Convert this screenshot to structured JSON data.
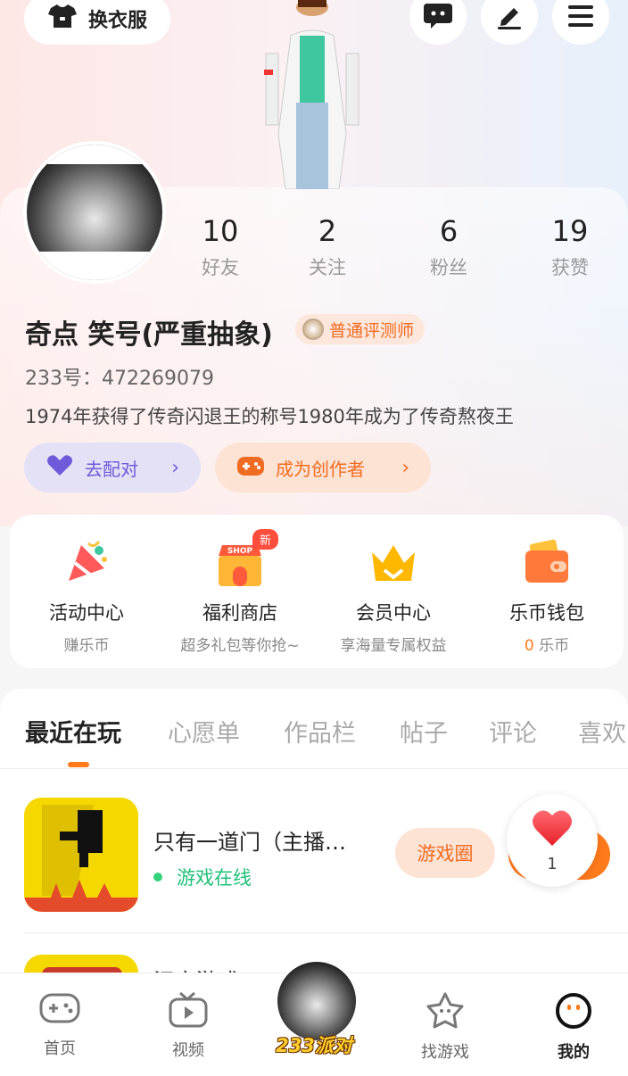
{
  "header": {
    "outfit_label": "换衣服",
    "icons": [
      "chat-icon",
      "edit-icon",
      "menu-icon"
    ]
  },
  "profile": {
    "stats": [
      {
        "value": "10",
        "label": "好友"
      },
      {
        "value": "2",
        "label": "关注"
      },
      {
        "value": "6",
        "label": "粉丝"
      },
      {
        "value": "19",
        "label": "获赞"
      }
    ],
    "username": "奇点 笑号(严重抽象)",
    "title_badge": "普通评测师",
    "uid": "233号：472269079",
    "bio": "1974年获得了传奇闪退王的称号1980年成为了传奇熬夜王",
    "match_label": "去配对",
    "creator_label": "成为创作者"
  },
  "actions": [
    {
      "name": "活动中心",
      "sub": "赚乐币"
    },
    {
      "name": "福利商店",
      "sub": "超多礼包等你抢~",
      "badge": "新",
      "sign": "SHOP"
    },
    {
      "name": "会员中心",
      "sub": "享海量专属权益"
    },
    {
      "name": "乐币钱包",
      "sub_value": "0",
      "sub_unit": " 乐币"
    }
  ],
  "tabs": [
    "最近在玩",
    "心愿单",
    "作品栏",
    "帖子",
    "评论",
    "喜欢"
  ],
  "games": [
    {
      "name": "只有一道门（主播…",
      "status": "游戏在线",
      "circle_label": "游戏圈"
    }
  ],
  "next_game_name_partial": "汉字游戏",
  "like_float": {
    "count": "1"
  },
  "nav": {
    "items": [
      {
        "label": "首页"
      },
      {
        "label": "视频"
      },
      {
        "label": "找游戏"
      },
      {
        "label": "我的"
      }
    ],
    "center_label": "233派对"
  },
  "colors": {
    "accent": "#ff7a1a",
    "purple": "#6f5ad9",
    "online": "#20c07a"
  }
}
